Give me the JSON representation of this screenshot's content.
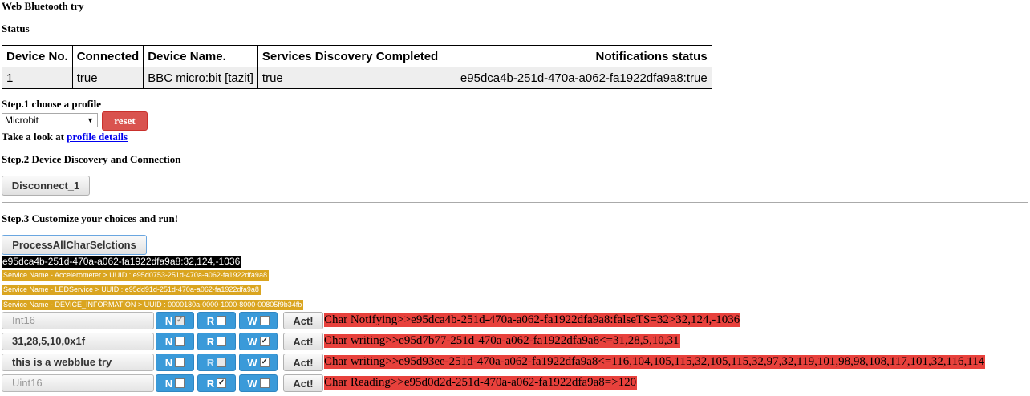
{
  "app": {
    "title": "Web Bluetooth try"
  },
  "status": {
    "heading": "Status",
    "columns": [
      "Device No.",
      "Connected",
      "Device Name.",
      "Services Discovery Completed",
      "Notifications status"
    ],
    "row": [
      "1",
      "true",
      "BBC micro:bit [tazit]",
      "true",
      "e95dca4b-251d-470a-a062-fa1922dfa9a8:true"
    ]
  },
  "step1": {
    "heading": "Step.1 choose a profile",
    "profile_selected": "Microbit",
    "reset_label": "reset",
    "look_prefix": "Take a look at ",
    "profile_link": "profile details"
  },
  "step2": {
    "heading": "Step.2 Device Discovery and Connection",
    "disconnect_label": "Disconnect_1"
  },
  "step3": {
    "heading": "Step.3 Customize your choices and run!",
    "process_label": "ProcessAllCharSelctions",
    "notification": "e95dca4b-251d-470a-a062-fa1922dfa9a8:32,124,-1036",
    "services": [
      "Service Name - Accelerometer > UUID : e95d0753-251d-470a-a062-fa1922dfa9a8",
      "Service Name - LEDService > UUID : e95dd91d-251d-470a-a062-fa1922dfa9a8",
      "Service Name - DEVICE_INFORMATION > UUID : 0000180a-0000-1000-8000-00805f9b34fb"
    ],
    "toggle_labels": {
      "n": "N",
      "r": "R",
      "w": "W"
    },
    "act_label": "Act!",
    "rows": [
      {
        "input": "Int16",
        "input_is_placeholder": true,
        "n_checked": true,
        "r_checked": false,
        "w_checked": false,
        "result": "Char Notifying>>e95dca4b-251d-470a-a062-fa1922dfa9a8:falseTS=32>32,124,-1036"
      },
      {
        "input": "31,28,5,10,0x1f",
        "input_is_placeholder": false,
        "n_checked": false,
        "r_checked": false,
        "w_checked": true,
        "result": "Char writing>>e95d7b77-251d-470a-a062-fa1922dfa9a8<=31,28,5,10,31"
      },
      {
        "input": "this is a webblue try",
        "input_is_placeholder": false,
        "n_checked": false,
        "r_checked": false,
        "w_checked": true,
        "result": "Char writing>>e95d93ee-251d-470a-a062-fa1922dfa9a8<=116,104,105,115,32,105,115,32,97,32,119,101,98,98,108,117,101,32,116,114"
      },
      {
        "input": "Uint16",
        "input_is_placeholder": true,
        "n_checked": false,
        "r_checked": true,
        "w_checked": false,
        "result": "Char Reading>>e95d0d2d-251d-470a-a062-fa1922dfa9a8=>120"
      }
    ]
  }
}
